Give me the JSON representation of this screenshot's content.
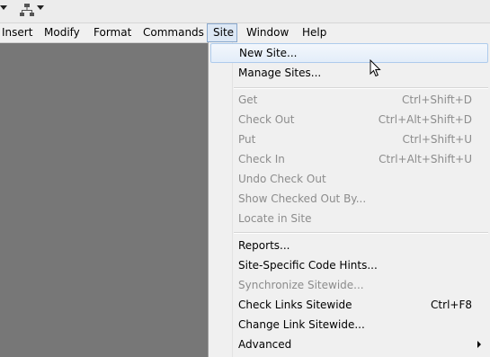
{
  "menubar": {
    "items": [
      {
        "label": "Insert"
      },
      {
        "label": "Modify"
      },
      {
        "label": "Format"
      },
      {
        "label": "Commands"
      },
      {
        "label": "Site"
      },
      {
        "label": "Window"
      },
      {
        "label": "Help"
      }
    ]
  },
  "site_menu": {
    "items": [
      {
        "label": "New Site...",
        "shortcut": "",
        "enabled": true,
        "highlighted": true
      },
      {
        "label": "Manage Sites...",
        "shortcut": "",
        "enabled": true
      },
      {
        "label": "Get",
        "shortcut": "Ctrl+Shift+D",
        "enabled": false
      },
      {
        "label": "Check Out",
        "shortcut": "Ctrl+Alt+Shift+D",
        "enabled": false
      },
      {
        "label": "Put",
        "shortcut": "Ctrl+Shift+U",
        "enabled": false
      },
      {
        "label": "Check In",
        "shortcut": "Ctrl+Alt+Shift+U",
        "enabled": false
      },
      {
        "label": "Undo Check Out",
        "shortcut": "",
        "enabled": false
      },
      {
        "label": "Show Checked Out By...",
        "shortcut": "",
        "enabled": false
      },
      {
        "label": "Locate in Site",
        "shortcut": "",
        "enabled": false
      },
      {
        "label": "Reports...",
        "shortcut": "",
        "enabled": true
      },
      {
        "label": "Site-Specific Code Hints...",
        "shortcut": "",
        "enabled": true
      },
      {
        "label": "Synchronize Sitewide...",
        "shortcut": "",
        "enabled": false
      },
      {
        "label": "Check Links Sitewide",
        "shortcut": "Ctrl+F8",
        "enabled": true
      },
      {
        "label": "Change Link Sitewide...",
        "shortcut": "",
        "enabled": true
      },
      {
        "label": "Advanced",
        "shortcut": "",
        "enabled": true,
        "submenu": true
      }
    ]
  },
  "icons": {
    "toolbar_dropdown_1": "chevron-down-icon",
    "toolbar_site_network": "site-network-icon",
    "cursor": "mouse-pointer-icon"
  },
  "colors": {
    "workspace": "#777777",
    "menu_background": "#f0f0f0",
    "highlight_border": "#aecbec",
    "disabled_text": "#8c8c8c"
  }
}
